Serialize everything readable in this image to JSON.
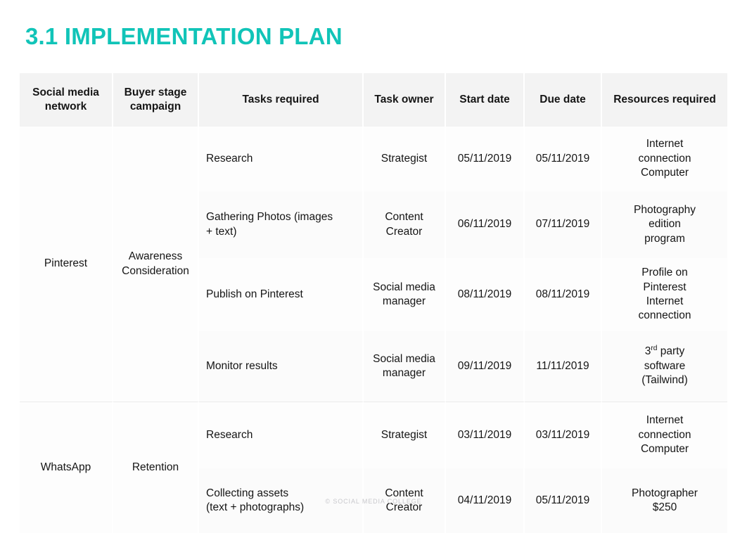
{
  "slide": {
    "title": "3.1 IMPLEMENTATION PLAN",
    "title_color": "#11c4b8",
    "footer": "© SOCIAL MEDIA COLLEGE",
    "background": "#ffffff"
  },
  "table": {
    "headers": {
      "network": "Social media network",
      "stage": "Buyer stage campaign",
      "tasks": "Tasks required",
      "owner": "Task owner",
      "start": "Start date",
      "due": "Due date",
      "resources": "Resources required"
    },
    "groups": [
      {
        "network": "Pinterest",
        "stage": "Awareness Consideration",
        "rows": [
          {
            "task": "Research",
            "owner": "Strategist",
            "start": "05/11/2019",
            "due": "05/11/2019",
            "resources_line1": "Internet",
            "resources_line2": "connection",
            "resources_line3": "Computer"
          },
          {
            "task_line1": "Gathering Photos (images",
            "task_line2": "+ text)",
            "owner_line1": "Content",
            "owner_line2": "Creator",
            "start": "06/11/2019",
            "due": "07/11/2019",
            "resources_line1": "Photography",
            "resources_line2": "edition",
            "resources_line3": "program"
          },
          {
            "task": "Publish on Pinterest",
            "owner_line1": "Social media",
            "owner_line2": "manager",
            "start": "08/11/2019",
            "due": "08/11/2019",
            "resources_line1": "Profile on",
            "resources_line2": "Pinterest",
            "resources_line3": "Internet",
            "resources_line4": "connection"
          },
          {
            "task": "Monitor results",
            "owner_line1": "Social media",
            "owner_line2": "manager",
            "start": "09/11/2019",
            "due": "11/11/2019",
            "resources_prefix": "3",
            "resources_sup": "rd",
            "resources_after": " party",
            "resources_line2": "software",
            "resources_line3": "(Tailwind)"
          }
        ]
      },
      {
        "network": "WhatsApp",
        "stage": "Retention",
        "rows": [
          {
            "task": "Research",
            "owner": "Strategist",
            "start": "03/11/2019",
            "due": "03/11/2019",
            "resources_line1": "Internet",
            "resources_line2": "connection",
            "resources_line3": "Computer"
          },
          {
            "task_line1": "Collecting assets",
            "task_line2": "(text + photographs)",
            "owner_line1": "Content",
            "owner_line2": "Creator",
            "start": "04/11/2019",
            "due": "05/11/2019",
            "resources_line1": "Photographer",
            "resources_line2": "$250"
          }
        ]
      }
    ]
  }
}
